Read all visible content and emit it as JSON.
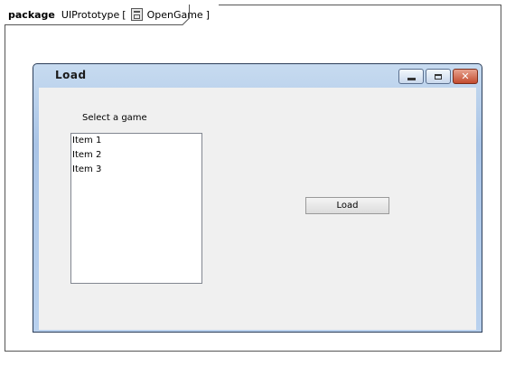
{
  "package": {
    "keyword": "package",
    "name": "UIPrototype",
    "bracket_open": "[",
    "diagram_name": "OpenGame",
    "bracket_close": "]"
  },
  "window": {
    "title": "Load",
    "controls": {
      "minimize_icon": "minimize-icon",
      "maximize_icon": "maximize-icon",
      "close_icon": "close-icon",
      "close_glyph": "✕"
    }
  },
  "form": {
    "label": "Select a game",
    "list_items": [
      "Item 1",
      "Item 2",
      "Item 3"
    ],
    "load_button": "Load"
  },
  "colors": {
    "close_button": "#c34b2f",
    "titlebar": "#b9d1ee",
    "client_bg": "#f0f0f0"
  }
}
